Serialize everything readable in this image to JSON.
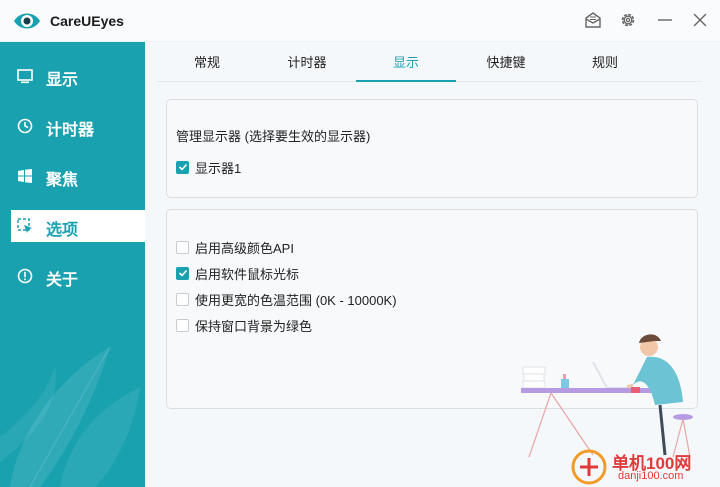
{
  "app": {
    "title": "CareUEyes"
  },
  "titlebar": {
    "icons": [
      "mail-icon",
      "gear-icon",
      "minimize-icon",
      "close-icon"
    ]
  },
  "sidebar": {
    "items": [
      {
        "label": "显示",
        "icon": "monitor-icon"
      },
      {
        "label": "计时器",
        "icon": "clock-icon"
      },
      {
        "label": "聚焦",
        "icon": "windows-icon"
      },
      {
        "label": "选项",
        "icon": "cursor-icon",
        "active": true
      },
      {
        "label": "关于",
        "icon": "info-icon"
      }
    ]
  },
  "tabs": [
    {
      "label": "常规"
    },
    {
      "label": "计时器"
    },
    {
      "label": "显示",
      "active": true
    },
    {
      "label": "快捷键"
    },
    {
      "label": "规则"
    }
  ],
  "display_panel": {
    "label": "管理显示器 (选择要生效的显示器)",
    "monitors": [
      {
        "label": "显示器1",
        "checked": true
      }
    ]
  },
  "options_panel": {
    "options": [
      {
        "label": "启用高级颜色API",
        "checked": false
      },
      {
        "label": "启用软件鼠标光标",
        "checked": true
      },
      {
        "label": "使用更宽的色温范围 (0K - 10000K)",
        "checked": false
      },
      {
        "label": "保持窗口背景为绿色",
        "checked": false
      }
    ]
  },
  "watermark": {
    "text": "单机100网",
    "sub": "danji100.com"
  },
  "colors": {
    "accent": "#1aa1b0",
    "background": "#f5f8fa"
  }
}
